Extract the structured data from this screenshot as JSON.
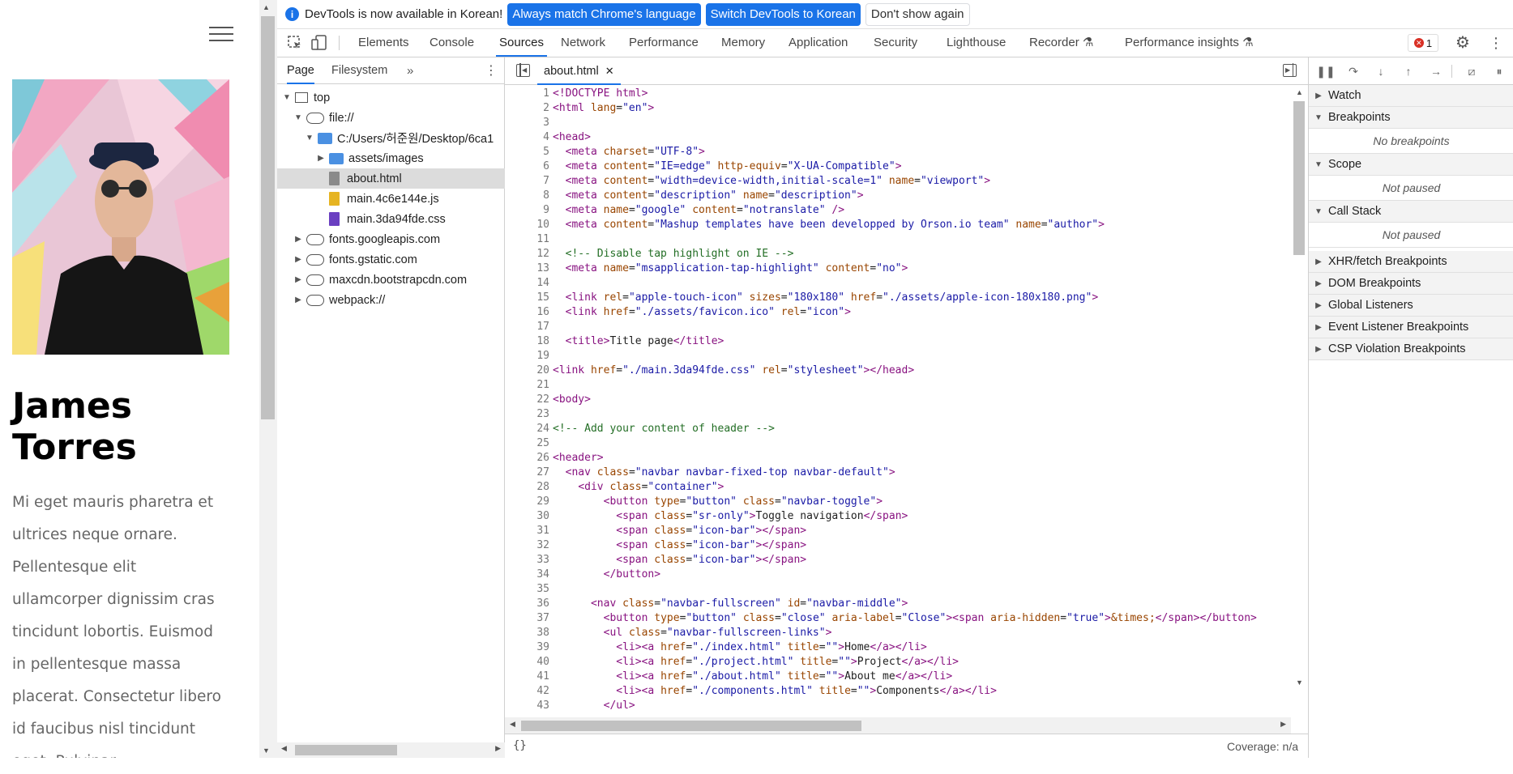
{
  "page": {
    "name_line1": "James",
    "name_line2": "Torres",
    "bio": "Mi eget mauris pharetra et ultrices neque ornare. Pellentesque elit ullamcorper dignissim cras tincidunt lobortis. Euismod in pellentesque massa placerat. Consectetur libero id faucibus nisl tincidunt eget. Pulvinar"
  },
  "infobar": {
    "message": "DevTools is now available in Korean!",
    "btn_match": "Always match Chrome's language",
    "btn_switch": "Switch DevTools to Korean",
    "btn_dismiss": "Don't show again"
  },
  "tabs": [
    "Elements",
    "Console",
    "Sources",
    "Network",
    "Performance",
    "Memory",
    "Application",
    "Security",
    "Lighthouse",
    "Recorder",
    "Performance insights"
  ],
  "error_count": "1",
  "navigator": {
    "tabs": [
      "Page",
      "Filesystem"
    ],
    "tree": [
      "top",
      "file://",
      "C:/Users/허준원/Desktop/6ca1",
      "assets/images",
      "about.html",
      "main.4c6e144e.js",
      "main.3da94fde.css",
      "fonts.googleapis.com",
      "fonts.gstatic.com",
      "maxcdn.bootstrapcdn.com",
      "webpack://"
    ]
  },
  "editor": {
    "file_tab": "about.html",
    "coverage": "Coverage: n/a",
    "pretty_print": "{}",
    "line_numbers": [
      "1",
      "2",
      "3",
      "4",
      "5",
      "6",
      "7",
      "8",
      "9",
      "10",
      "11",
      "12",
      "13",
      "14",
      "15",
      "16",
      "17",
      "18",
      "19",
      "20",
      "21",
      "22",
      "23",
      "24",
      "25",
      "26",
      "27",
      "28",
      "29",
      "30",
      "31",
      "32",
      "33",
      "34",
      "35",
      "36",
      "37",
      "38",
      "39",
      "40",
      "41",
      "42",
      "43"
    ]
  },
  "debugger": {
    "watch": "Watch",
    "breakpoints": "Breakpoints",
    "no_breakpoints": "No breakpoints",
    "scope": "Scope",
    "scope_note": "Not paused",
    "callstack": "Call Stack",
    "callstack_note": "Not paused",
    "xhr": "XHR/fetch Breakpoints",
    "dom": "DOM Breakpoints",
    "global": "Global Listeners",
    "event": "Event Listener Breakpoints",
    "csp": "CSP Violation Breakpoints"
  },
  "colors": {
    "accent": "#1a73e8",
    "tag": "#881280",
    "attr": "#994500",
    "value": "#1a1aa6",
    "comment": "#236e25"
  }
}
